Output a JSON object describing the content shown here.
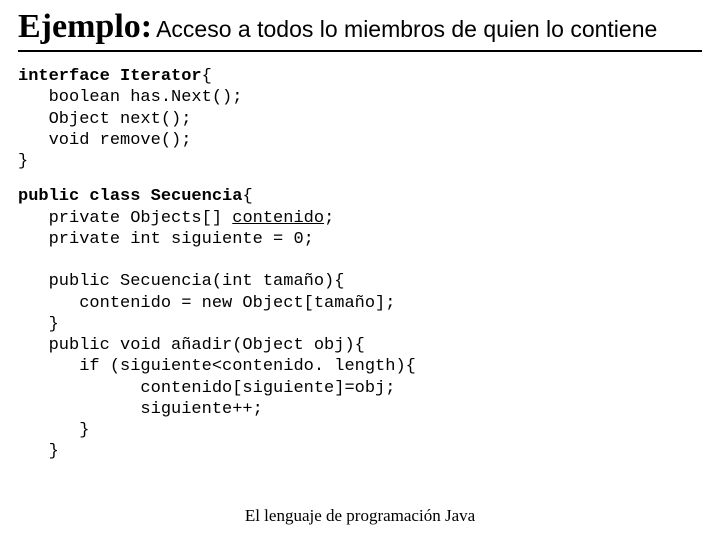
{
  "title": {
    "main": "Ejemplo:",
    "sub": "Acceso a todos lo miembros de quien lo contiene"
  },
  "code1": {
    "l1a": "interface Iterator",
    "l1b": "{",
    "l2": "   boolean has.Next();",
    "l3": "   Object next();",
    "l4": "   void remove();",
    "l5": "}"
  },
  "code2": {
    "l1a": "public class Secuencia",
    "l1b": "{",
    "l2a": "   private Objects[] ",
    "l2b": "contenido",
    "l2c": ";",
    "l3": "   private int siguiente = 0;",
    "blank1": "",
    "l4": "   public Secuencia(int tamaño){",
    "l5": "      contenido = new Object[tamaño];",
    "l6": "   }",
    "l7": "   public void añadir(Object obj){",
    "l8": "      if (siguiente<contenido. length){",
    "l9": "            contenido[siguiente]=obj;",
    "l10": "            siguiente++;",
    "l11": "      }",
    "l12": "   }"
  },
  "footer": "El lenguaje de programación Java"
}
